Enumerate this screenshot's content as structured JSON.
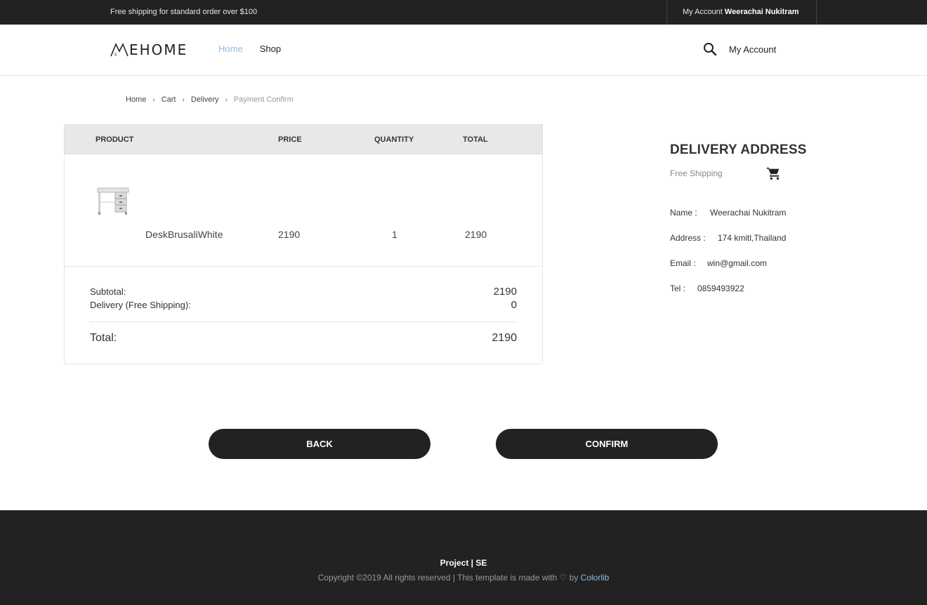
{
  "topbar": {
    "shipping_notice": "Free shipping for standard order over $100",
    "account_prefix": "My Account",
    "account_name": "Weerachai Nukitram"
  },
  "header": {
    "logo_text": "EHOME",
    "nav": {
      "home": "Home",
      "shop": "Shop"
    },
    "icons": {
      "search": "search-icon",
      "cart": "cart-icon"
    },
    "account_link": "My Account"
  },
  "breadcrumb": {
    "items": [
      "Home",
      "Cart",
      "Delivery"
    ],
    "current": "Payment Confirm"
  },
  "cart": {
    "headers": {
      "product": "PRODUCT",
      "price": "PRICE",
      "quantity": "QUANTITY",
      "total": "TOTAL"
    },
    "items": [
      {
        "name": "DeskBrusaliWhite",
        "price": "2190",
        "quantity": "1",
        "total": "2190",
        "icon": "desk-thumbnail"
      }
    ],
    "summary": {
      "subtotal_label": "Subtotal:",
      "subtotal_value": "2190",
      "delivery_label": "Delivery (Free Shipping):",
      "delivery_value": "0",
      "total_label": "Total:",
      "total_value": "2190"
    }
  },
  "delivery": {
    "title": "DELIVERY ADDRESS",
    "shipping_type": "Free Shipping",
    "name_label": "Name :",
    "name_value": "Weerachai Nukitram",
    "address_label": "Address :",
    "address_value": "174 kmitl,Thailand",
    "email_label": "Email :",
    "email_value": "win@gmail.com",
    "tel_label": "Tel :",
    "tel_value": "0859493922"
  },
  "actions": {
    "back": "BACK",
    "confirm": "CONFIRM"
  },
  "footer": {
    "project": "Project | SE",
    "copyright": "Copyright ©2019 All rights reserved | This template is made with",
    "by": "by",
    "credit": "Colorlib"
  },
  "colors": {
    "dark": "#222222",
    "accent": "#8fbde6",
    "table_header": "#e8e8e8"
  }
}
